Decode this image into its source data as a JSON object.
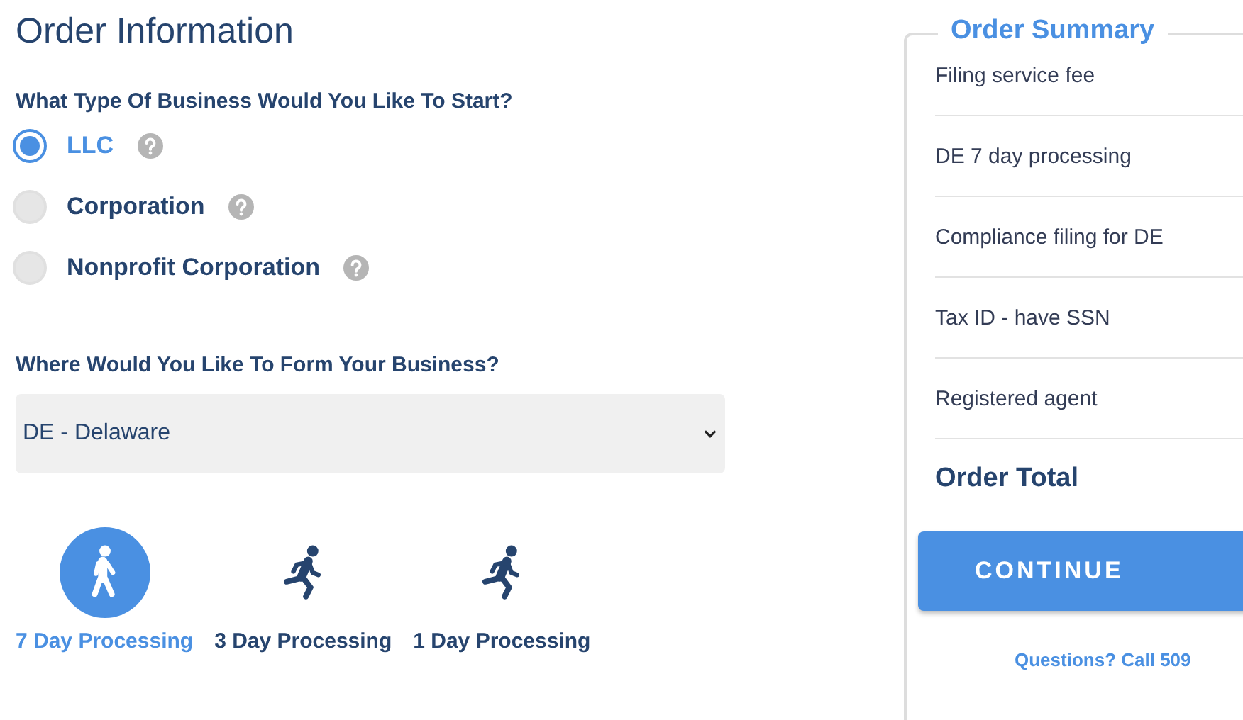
{
  "title": "Order Information",
  "business_question": "What Type Of Business Would You Like To Start?",
  "business_types": [
    {
      "label": "LLC",
      "selected": true
    },
    {
      "label": "Corporation",
      "selected": false
    },
    {
      "label": "Nonprofit Corporation",
      "selected": false
    }
  ],
  "state_question": "Where Would You Like To Form Your Business?",
  "state_select": {
    "value": "DE - Delaware"
  },
  "processing": [
    {
      "label": "7 Day Processing",
      "kind": "walk",
      "selected": true
    },
    {
      "label": "3 Day Processing",
      "kind": "run",
      "selected": false
    },
    {
      "label": "1 Day Processing",
      "kind": "run",
      "selected": false
    }
  ],
  "summary": {
    "title": "Order Summary",
    "items": [
      "Filing service fee",
      "DE 7 day processing",
      "Compliance filing for DE",
      "Tax ID - have SSN",
      "Registered agent"
    ],
    "total_label": "Order Total",
    "button": "CONTINUE",
    "questions": "Questions? Call 509"
  }
}
